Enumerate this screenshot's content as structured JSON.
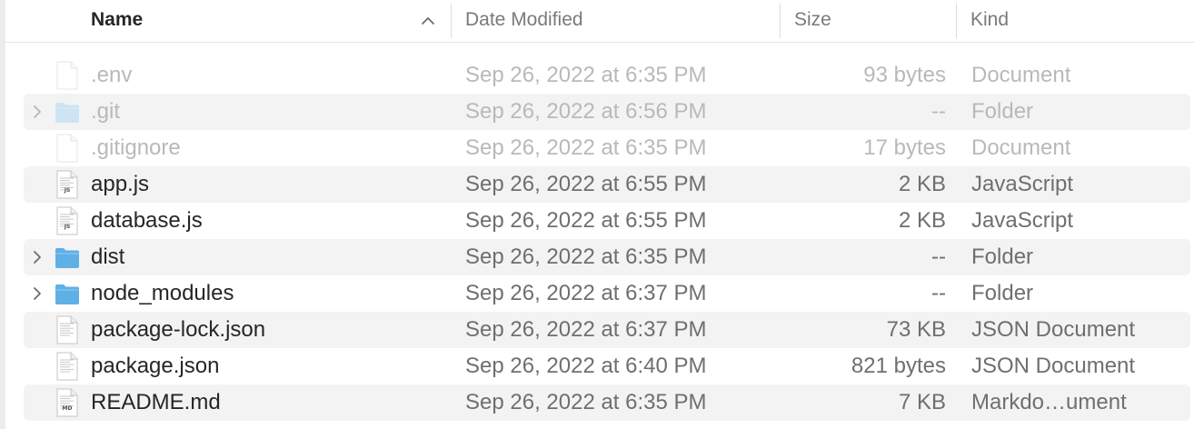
{
  "header": {
    "name_label": "Name",
    "date_label": "Date Modified",
    "size_label": "Size",
    "kind_label": "Kind",
    "sort_icon": "chevron-up-icon"
  },
  "colors": {
    "folder": "#5fb0e6",
    "folder_light": "#9fd2f3",
    "dim_text": "#b9b9b9",
    "row_stripe": "#f3f3f4"
  },
  "files": [
    {
      "name": ".env",
      "date": "Sep 26, 2022 at 6:35 PM",
      "size": "93 bytes",
      "kind": "Document",
      "icon": "document-icon",
      "hidden": true,
      "folder": false,
      "badge": ""
    },
    {
      "name": ".git",
      "date": "Sep 26, 2022 at 6:56 PM",
      "size": "--",
      "kind": "Folder",
      "icon": "folder-icon",
      "hidden": true,
      "folder": true,
      "badge": ""
    },
    {
      "name": ".gitignore",
      "date": "Sep 26, 2022 at 6:35 PM",
      "size": "17 bytes",
      "kind": "Document",
      "icon": "document-icon",
      "hidden": true,
      "folder": false,
      "badge": ""
    },
    {
      "name": "app.js",
      "date": "Sep 26, 2022 at 6:55 PM",
      "size": "2 KB",
      "kind": "JavaScript",
      "icon": "javascript-file-icon",
      "hidden": false,
      "folder": false,
      "badge": "JS"
    },
    {
      "name": "database.js",
      "date": "Sep 26, 2022 at 6:55 PM",
      "size": "2 KB",
      "kind": "JavaScript",
      "icon": "javascript-file-icon",
      "hidden": false,
      "folder": false,
      "badge": "JS"
    },
    {
      "name": "dist",
      "date": "Sep 26, 2022 at 6:35 PM",
      "size": "--",
      "kind": "Folder",
      "icon": "folder-icon",
      "hidden": false,
      "folder": true,
      "badge": ""
    },
    {
      "name": "node_modules",
      "date": "Sep 26, 2022 at 6:37 PM",
      "size": "--",
      "kind": "Folder",
      "icon": "folder-icon",
      "hidden": false,
      "folder": true,
      "badge": ""
    },
    {
      "name": "package-lock.json",
      "date": "Sep 26, 2022 at 6:37 PM",
      "size": "73 KB",
      "kind": "JSON Document",
      "icon": "json-file-icon",
      "hidden": false,
      "folder": false,
      "badge": ""
    },
    {
      "name": "package.json",
      "date": "Sep 26, 2022 at 6:40 PM",
      "size": "821 bytes",
      "kind": "JSON Document",
      "icon": "json-file-icon",
      "hidden": false,
      "folder": false,
      "badge": ""
    },
    {
      "name": "README.md",
      "date": "Sep 26, 2022 at 6:35 PM",
      "size": "7 KB",
      "kind": "Markdo…ument",
      "icon": "markdown-file-icon",
      "hidden": false,
      "folder": false,
      "badge": "MD"
    }
  ]
}
